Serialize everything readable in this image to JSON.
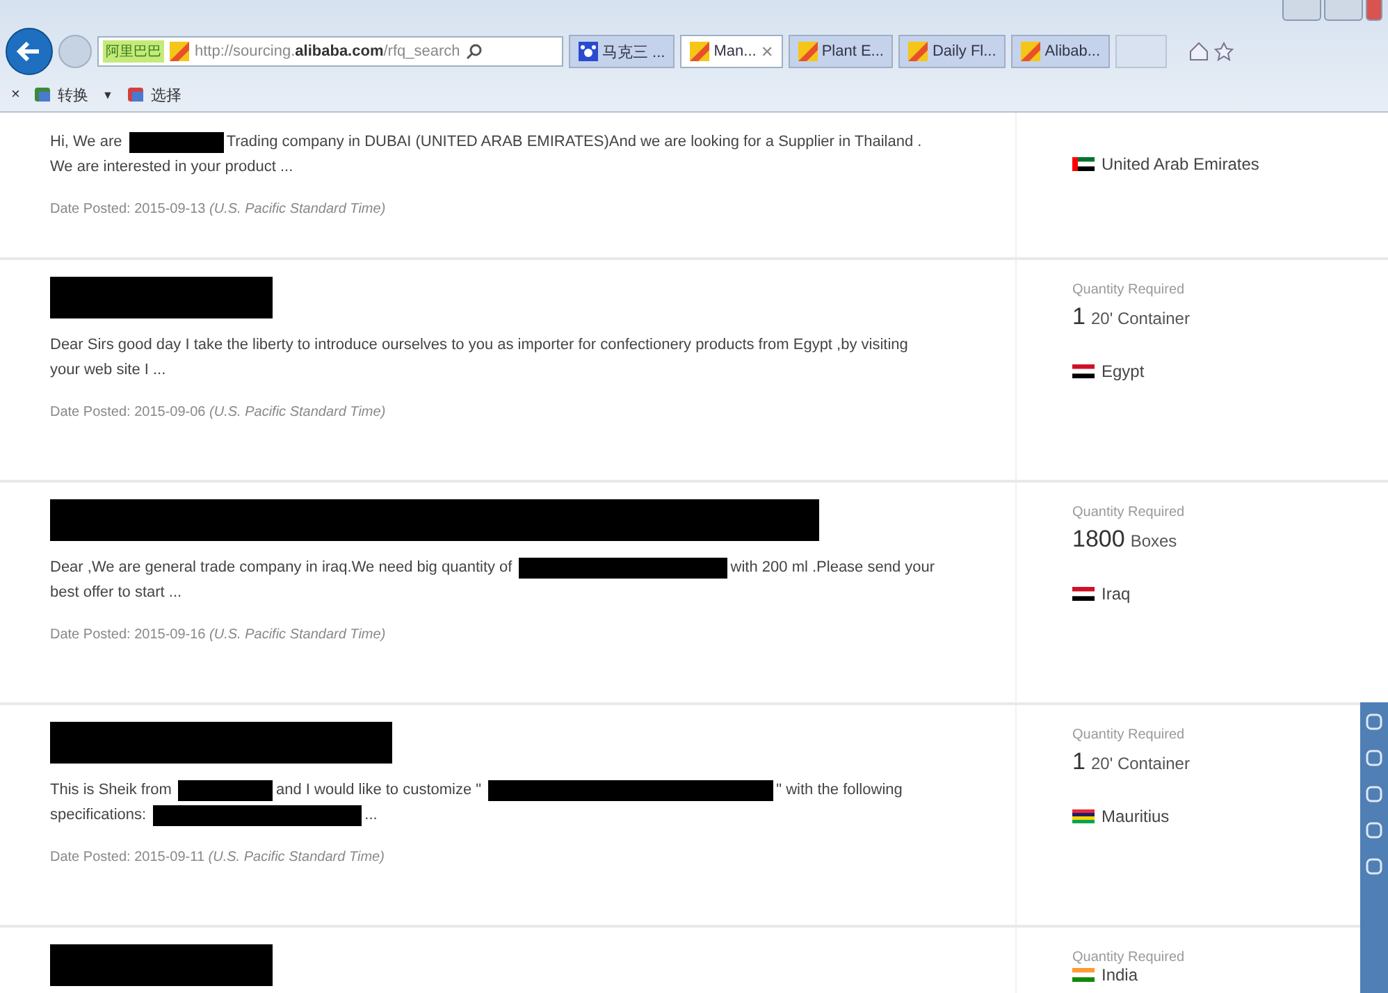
{
  "browser": {
    "address": {
      "site_label": "阿里巴巴",
      "url": "http://sourcing.**alibaba.com**/rfq_search"
    },
    "tabs": [
      {
        "label": "马克三 ...",
        "selected": false,
        "kind": "paw"
      },
      {
        "label": "Man...",
        "selected": true,
        "kind": "site",
        "close": "✕"
      },
      {
        "label": "Plant E...",
        "selected": false,
        "kind": "site"
      },
      {
        "label": "Daily Fl...",
        "selected": false,
        "kind": "site"
      },
      {
        "label": "Alibab...",
        "selected": false,
        "kind": "site"
      }
    ],
    "command_bar": {
      "close": "×",
      "items": [
        {
          "kind": "icon-label",
          "label": "转换"
        },
        {
          "kind": "caret",
          "label": "▼"
        },
        {
          "kind": "icon-label",
          "label": "选择"
        }
      ]
    }
  },
  "requests": [
    {
      "message": [
        {
          "kind": "text",
          "text": "Hi, We are"
        },
        {
          "kind": "redacted-short"
        },
        {
          "kind": "text",
          "text": "Trading company in DUBAI (UNITED ARAB EMIRATES)And we are looking for a Supplier in Thailand . We are interested in your product ..."
        }
      ],
      "date": "Date Posted: 2015-09-13",
      "timezone": "(U.S. Pacific Standard Time)",
      "country": {
        "name": "United Arab Emirates",
        "kind": "uae"
      }
    },
    {
      "title": {
        "kind": "short"
      },
      "message": [
        {
          "kind": "text",
          "text": "Dear Sirs good day I take the liberty to introduce ourselves to you as importer for confectionery products from Egypt ,by visiting your web site I ..."
        }
      ],
      "date": "Date Posted: 2015-09-06",
      "timezone": "(U.S. Pacific Standard Time)",
      "quantity": {
        "label": "Quantity Required",
        "amount": "1",
        "unit": "20' Container"
      },
      "country": {
        "name": "Egypt",
        "kind": "egypt"
      }
    },
    {
      "title": {
        "kind": "long"
      },
      "message": [
        {
          "kind": "text",
          "text": "Dear ,We are general trade company in iraq.We need big quantity of"
        },
        {
          "kind": "redacted-medium"
        },
        {
          "kind": "text",
          "text": "with 200 ml .Please send your best offer to start ..."
        }
      ],
      "date": "Date Posted: 2015-09-16",
      "timezone": "(U.S. Pacific Standard Time)",
      "quantity": {
        "label": "Quantity Required",
        "amount": "1800",
        "unit": "Boxes"
      },
      "country": {
        "name": "Iraq",
        "kind": "iraq"
      }
    },
    {
      "title": {
        "kind": "medium"
      },
      "message": [
        {
          "kind": "text",
          "text": "This is Sheik from"
        },
        {
          "kind": "redacted-short"
        },
        {
          "kind": "text",
          "text": "and I would like to customize \""
        },
        {
          "kind": "redacted-long"
        },
        {
          "kind": "text",
          "text": "\" with the following specifications:"
        },
        {
          "kind": "redacted-medium"
        },
        {
          "kind": "text",
          "text": "..."
        }
      ],
      "date": "Date Posted: 2015-09-11",
      "timezone": "(U.S. Pacific Standard Time)",
      "quantity": {
        "label": "Quantity Required",
        "amount": "1",
        "unit": "20' Container"
      },
      "country": {
        "name": "Mauritius",
        "kind": "mauritius"
      }
    },
    {
      "title": {
        "kind": "short"
      },
      "quantity": {
        "label": "Quantity Required"
      },
      "country": {
        "name": "India",
        "kind": "india"
      }
    }
  ]
}
